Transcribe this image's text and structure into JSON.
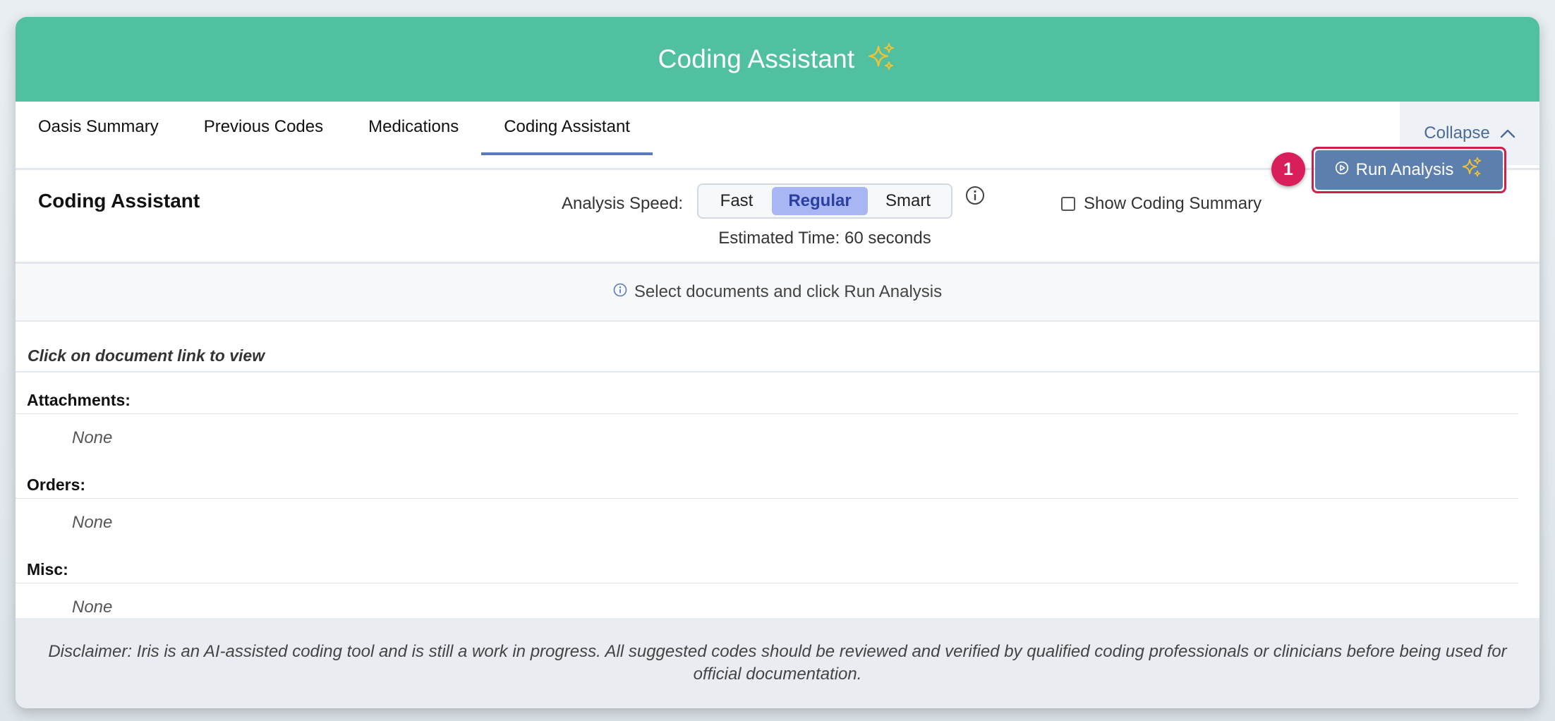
{
  "header": {
    "title": "Coding Assistant",
    "icon": "sparkle-icon",
    "sparkle_color": "#f2c230",
    "bg_color": "#51c0a1"
  },
  "tabs": [
    {
      "label": "Oasis Summary",
      "active": false
    },
    {
      "label": "Previous Codes",
      "active": false
    },
    {
      "label": "Medications",
      "active": false
    },
    {
      "label": "Coding Assistant",
      "active": true
    }
  ],
  "collapse": {
    "label": "Collapse",
    "icon": "chevron-up-icon"
  },
  "toolbar": {
    "title": "Coding Assistant",
    "speed_label": "Analysis Speed:",
    "speed_options": [
      {
        "label": "Fast",
        "selected": false
      },
      {
        "label": "Regular",
        "selected": true
      },
      {
        "label": "Smart",
        "selected": false
      }
    ],
    "estimated_time": "Estimated Time: 60 seconds",
    "show_summary_label": "Show Coding Summary",
    "show_summary_checked": false,
    "step_badge": "1",
    "run_label": "Run Analysis",
    "run_color": "#5c7fad",
    "highlight_color": "#d01f4d"
  },
  "hint": {
    "icon": "info-icon",
    "text": "Select documents and click Run Analysis"
  },
  "documents": {
    "link_hint": "Click on document link to view",
    "sections": [
      {
        "title": "Attachments:",
        "value": "None"
      },
      {
        "title": "Orders:",
        "value": "None"
      },
      {
        "title": "Misc:",
        "value": "None"
      }
    ]
  },
  "disclaimer": "Disclaimer: Iris is an AI-assisted coding tool and is still a work in progress. All suggested codes should be reviewed and verified by qualified coding professionals or clinicians before being used for official documentation."
}
